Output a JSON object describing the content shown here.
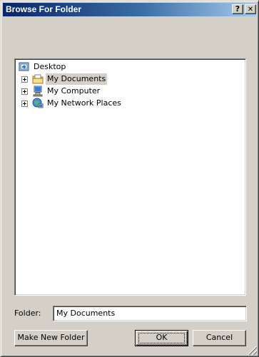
{
  "window": {
    "title": "Browse For Folder",
    "help_glyph": "?",
    "close_glyph": "✕"
  },
  "tree": {
    "items": [
      {
        "label": "Desktop",
        "icon": "desktop-icon"
      },
      {
        "label": "My Documents",
        "icon": "documents-folder-icon",
        "selected": true
      },
      {
        "label": "My Computer",
        "icon": "computer-icon"
      },
      {
        "label": "My Network Places",
        "icon": "network-places-icon"
      }
    ]
  },
  "folder": {
    "label": "Folder:",
    "value": "My Documents"
  },
  "buttons": {
    "make_new_folder": "Make New Folder",
    "ok": "OK",
    "cancel": "Cancel"
  },
  "colors": {
    "titlebar_start": "#0a246a",
    "titlebar_end": "#a6caf0",
    "face": "#d4d0c8"
  }
}
